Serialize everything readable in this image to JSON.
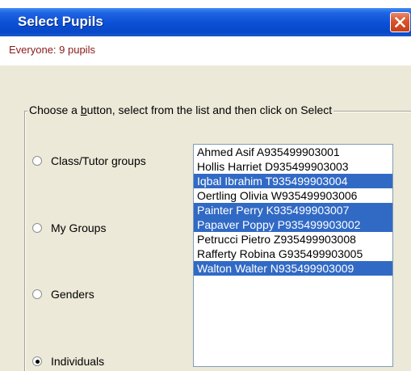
{
  "window": {
    "title": "Select Pupils",
    "close_icon": "close-x-icon"
  },
  "summary": {
    "text": "Everyone: 9 pupils"
  },
  "group": {
    "legend": "Choose a button, select from the list and then click on Select",
    "options": [
      {
        "label": "Class/Tutor groups",
        "checked": false
      },
      {
        "label": "My Groups",
        "checked": false
      },
      {
        "label": "Genders",
        "checked": false
      },
      {
        "label": "Individuals",
        "checked": true
      }
    ]
  },
  "pupils": {
    "items": [
      {
        "text": "Ahmed Asif A935499903001",
        "selected": false
      },
      {
        "text": "Hollis Harriet D935499903003",
        "selected": false
      },
      {
        "text": "Iqbal Ibrahim T935499903004",
        "selected": true
      },
      {
        "text": "Oertling Olivia W935499903006",
        "selected": false
      },
      {
        "text": "Painter Perry K935499903007",
        "selected": true
      },
      {
        "text": "Papaver Poppy P935499903002",
        "selected": true
      },
      {
        "text": "Petrucci Pietro Z935499903008",
        "selected": false
      },
      {
        "text": "Rafferty Robina G935499903005",
        "selected": false
      },
      {
        "text": "Walton Walter N935499903009",
        "selected": true
      }
    ],
    "selection_color": "#316ac5"
  }
}
